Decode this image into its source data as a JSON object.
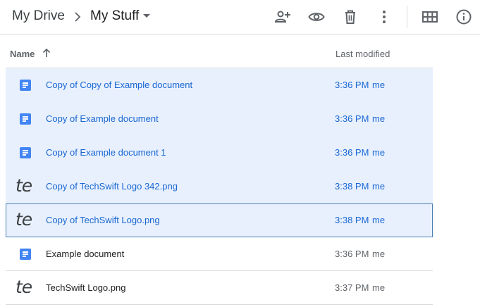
{
  "breadcrumb": {
    "root": "My Drive",
    "current": "My Stuff"
  },
  "toolbar": {
    "icons": [
      "share-icon",
      "preview-icon",
      "trash-icon",
      "more-vert-icon",
      "grid-view-icon",
      "info-icon"
    ]
  },
  "columns": {
    "name": "Name",
    "modified": "Last modified"
  },
  "files": [
    {
      "name": "Copy of Copy of Example document",
      "time": "3:36 PM",
      "owner": "me",
      "type": "doc",
      "selected": true
    },
    {
      "name": "Copy of Example document",
      "time": "3:36 PM",
      "owner": "me",
      "type": "doc",
      "selected": true
    },
    {
      "name": "Copy of Example document 1",
      "time": "3:36 PM",
      "owner": "me",
      "type": "doc",
      "selected": true
    },
    {
      "name": "Copy of TechSwift Logo 342.png",
      "time": "3:38 PM",
      "owner": "me",
      "type": "image",
      "selected": true
    },
    {
      "name": "Copy of TechSwift Logo.png",
      "time": "3:38 PM",
      "owner": "me",
      "type": "image",
      "selected": true,
      "focused": true
    },
    {
      "name": "Example document",
      "time": "3:36 PM",
      "owner": "me",
      "type": "doc",
      "selected": false
    },
    {
      "name": "TechSwift Logo.png",
      "time": "3:37 PM",
      "owner": "me",
      "type": "image",
      "selected": false
    }
  ],
  "thumbnail_text": "te",
  "colors": {
    "accent": "#1967d2",
    "selection": "#e8f0fe",
    "doc_blue": "#4285f4",
    "focus_border": "#4a7eb2"
  }
}
